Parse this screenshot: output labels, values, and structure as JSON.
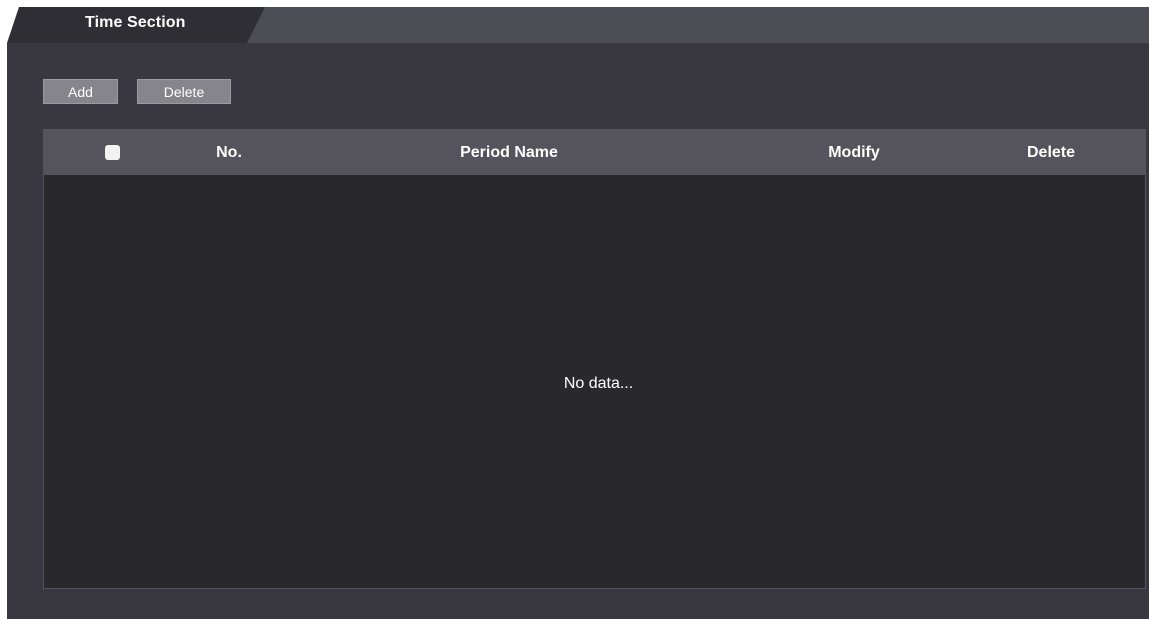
{
  "tab": {
    "title": "Time Section"
  },
  "toolbar": {
    "add_label": "Add",
    "delete_label": "Delete"
  },
  "table": {
    "columns": [
      "No.",
      "Period Name",
      "Modify",
      "Delete"
    ],
    "rows": [],
    "empty_text": "No data..."
  },
  "colors": {
    "panel": "#393840",
    "tabbar": "#4d4d55",
    "active_tab": "#2f2e34",
    "header": "#55545c",
    "table_body": "#29282d",
    "button": "#85858b"
  }
}
